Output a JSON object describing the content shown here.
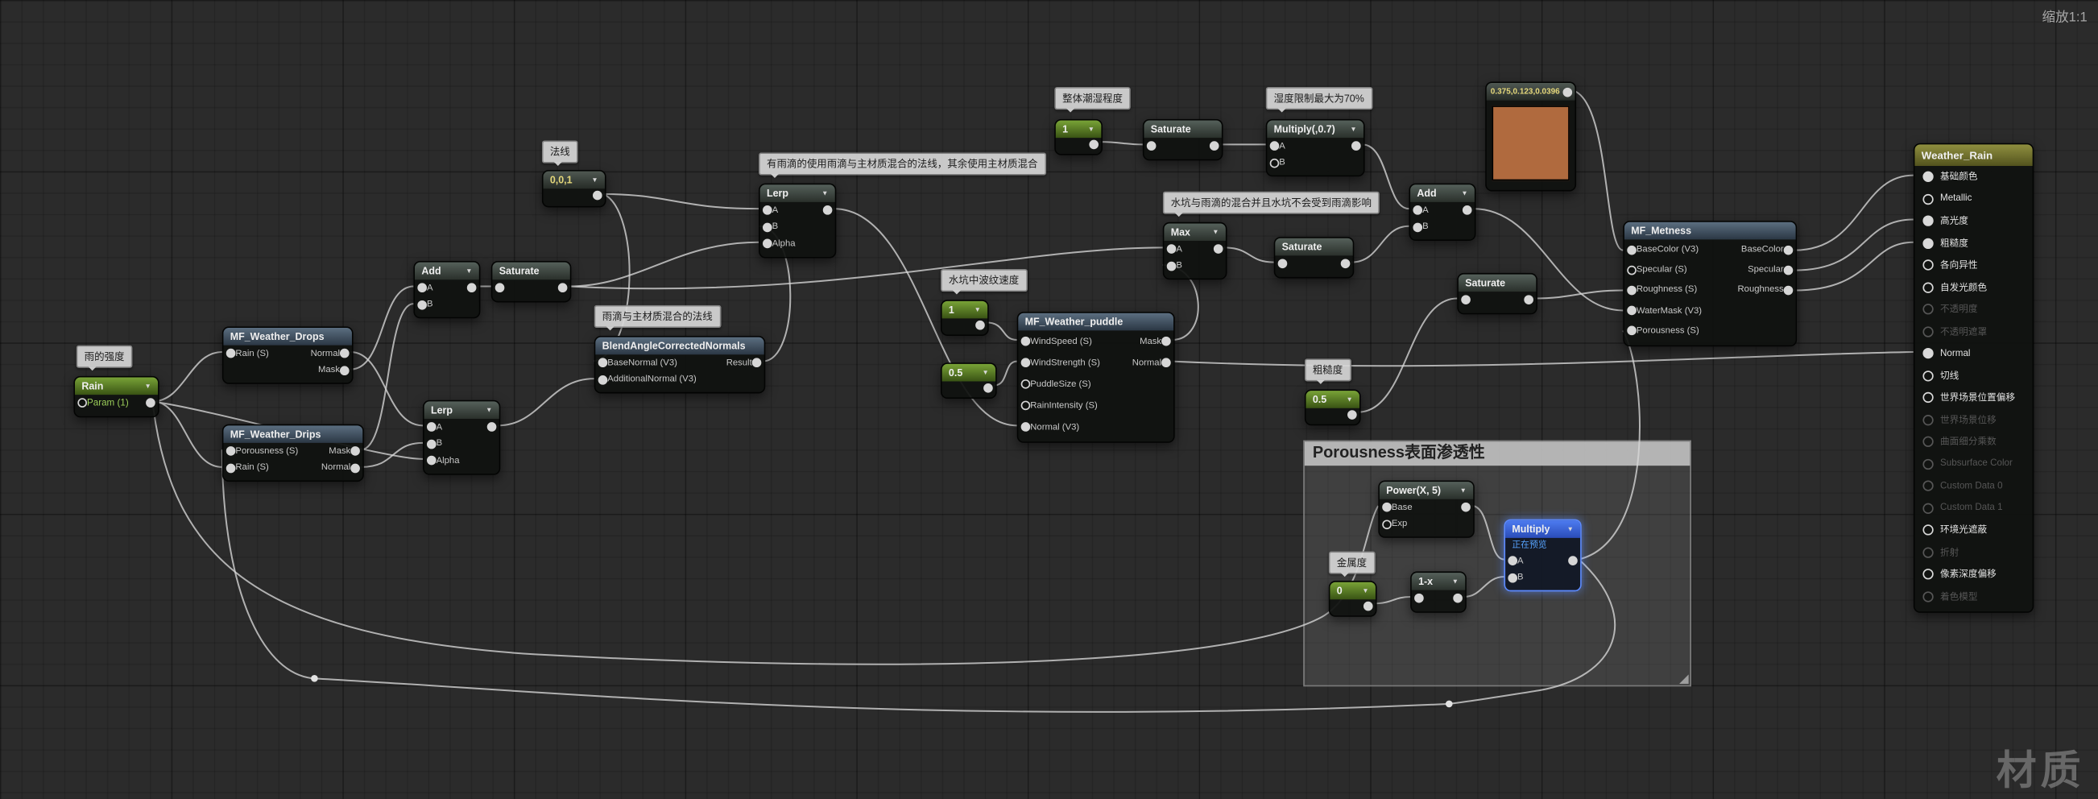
{
  "ui": {
    "zoom_label": "缩放1:1",
    "watermark": "材质"
  },
  "comment_box": {
    "title": "Porousness表面渗透性"
  },
  "comments": [
    {
      "id": "rain-strength",
      "text": "雨的强度"
    },
    {
      "id": "normal",
      "text": "法线"
    },
    {
      "id": "blend-normal",
      "text": "雨滴与主材质混合的法线"
    },
    {
      "id": "normal-choice",
      "text": "有雨滴的使用雨滴与主材质混合的法线，其余使用主材质混合"
    },
    {
      "id": "ripple-speed",
      "text": "水坑中波纹速度"
    },
    {
      "id": "overall-wetness",
      "text": "整体潮湿程度"
    },
    {
      "id": "wetness-limit",
      "text": "湿度限制最大为70%"
    },
    {
      "id": "puddle-drop-mix",
      "text": "水坑与雨滴的混合并且水坑不会受到雨滴影响"
    },
    {
      "id": "roughness",
      "text": "粗糙度"
    },
    {
      "id": "metallic",
      "text": "金属度"
    }
  ],
  "nodes": [
    {
      "id": "rain",
      "type": "param",
      "title": "Rain",
      "arrow": true,
      "rows": [
        {
          "in": "Param (1)",
          "out": "",
          "outf": true
        }
      ]
    },
    {
      "id": "drops",
      "type": "mf",
      "title": "MF_Weather_Drops",
      "rows": [
        {
          "in": "Rain (S)",
          "inf": true,
          "out": "Normal",
          "outf": true
        },
        {
          "out": "Mask",
          "outf": true
        }
      ]
    },
    {
      "id": "drips",
      "type": "mf",
      "title": "MF_Weather_Drips",
      "rows": [
        {
          "in": "Porousness (S)",
          "inf": true,
          "out": "Mask",
          "outf": true
        },
        {
          "in": "Rain (S)",
          "inf": true,
          "out": "Normal",
          "outf": true
        }
      ]
    },
    {
      "id": "add1",
      "type": "op",
      "title": "Add",
      "arrow": true,
      "rows": [
        {
          "in": "A",
          "inf": true,
          "out": "",
          "outf": true
        },
        {
          "in": "B",
          "inf": true
        }
      ]
    },
    {
      "id": "sat1",
      "type": "op",
      "title": "Saturate",
      "rows": [
        {
          "in": "",
          "inf": true,
          "out": "",
          "outf": true
        }
      ]
    },
    {
      "id": "vec001",
      "type": "const3",
      "title": "0,0,1",
      "arrow": true,
      "rows": [
        {
          "out": "",
          "outf": true
        }
      ]
    },
    {
      "id": "lerp1",
      "type": "op",
      "title": "Lerp",
      "arrow": true,
      "rows": [
        {
          "in": "A",
          "inf": true,
          "out": "",
          "outf": true
        },
        {
          "in": "B",
          "inf": true
        },
        {
          "in": "Alpha",
          "inf": true
        }
      ]
    },
    {
      "id": "blend",
      "type": "mf",
      "title": "BlendAngleCorrectedNormals",
      "rows": [
        {
          "in": "BaseNormal (V3)",
          "inf": true,
          "out": "Result",
          "outf": true
        },
        {
          "in": "AdditionalNormal (V3)",
          "inf": true
        }
      ]
    },
    {
      "id": "lerp2",
      "type": "op",
      "title": "Lerp",
      "arrow": true,
      "rows": [
        {
          "in": "A",
          "inf": true,
          "out": "",
          "outf": true
        },
        {
          "in": "B",
          "inf": true
        },
        {
          "in": "Alpha",
          "inf": true
        }
      ]
    },
    {
      "id": "one1",
      "type": "const",
      "title": "1",
      "arrow": true,
      "rows": [
        {
          "out": "",
          "outf": true
        }
      ]
    },
    {
      "id": "half1",
      "type": "const",
      "title": "0.5",
      "arrow": true,
      "rows": [
        {
          "out": "",
          "outf": true
        }
      ]
    },
    {
      "id": "puddle",
      "type": "mf",
      "title": "MF_Weather_puddle",
      "rows": [
        {
          "in": "WindSpeed (S)",
          "inf": true,
          "out": "Mask",
          "outf": true
        },
        {
          "in": "WindStrength (S)",
          "inf": true,
          "out": "Normal",
          "outf": true
        },
        {
          "in": "PuddleSize (S)"
        },
        {
          "in": "RainIntensity (S)"
        },
        {
          "in": "Normal (V3)",
          "inf": true
        }
      ]
    },
    {
      "id": "one2",
      "type": "const",
      "title": "1",
      "arrow": true,
      "rows": [
        {
          "out": "",
          "outf": true
        }
      ]
    },
    {
      "id": "sat2",
      "type": "op",
      "title": "Saturate",
      "rows": [
        {
          "in": "",
          "inf": true,
          "out": "",
          "outf": true
        }
      ]
    },
    {
      "id": "mul07",
      "type": "op",
      "title": "Multiply(,0.7)",
      "arrow": true,
      "rows": [
        {
          "in": "A",
          "inf": true,
          "out": "",
          "outf": true
        },
        {
          "in": "B"
        }
      ]
    },
    {
      "id": "max1",
      "type": "op",
      "title": "Max",
      "arrow": true,
      "rows": [
        {
          "in": "A",
          "inf": true,
          "out": "",
          "outf": true
        },
        {
          "in": "B",
          "inf": true
        }
      ]
    },
    {
      "id": "sat3",
      "type": "op",
      "title": "Saturate",
      "rows": [
        {
          "in": "",
          "inf": true,
          "out": "",
          "outf": true
        }
      ]
    },
    {
      "id": "add2",
      "type": "op",
      "title": "Add",
      "arrow": true,
      "rows": [
        {
          "in": "A",
          "inf": true,
          "out": "",
          "outf": true
        },
        {
          "in": "B",
          "inf": true
        }
      ]
    },
    {
      "id": "swatch",
      "type": "color",
      "title": "0.375,0.123,0.0396",
      "color": "#b06a3e",
      "rows": []
    },
    {
      "id": "sat4",
      "type": "op",
      "title": "Saturate",
      "rows": [
        {
          "in": "",
          "inf": true,
          "out": "",
          "outf": true
        }
      ]
    },
    {
      "id": "metness",
      "type": "mf",
      "title": "MF_Metness",
      "rows": [
        {
          "in": "BaseColor (V3)",
          "inf": true,
          "out": "BaseColor",
          "outf": true
        },
        {
          "in": "Specular (S)",
          "out": "Specular",
          "outf": true
        },
        {
          "in": "Roughness (S)",
          "inf": true,
          "out": "Roughness",
          "outf": true
        },
        {
          "in": "WaterMask (V3)",
          "inf": true
        },
        {
          "in": "Porousness (S)",
          "inf": true
        }
      ]
    },
    {
      "id": "half2",
      "type": "const",
      "title": "0.5",
      "arrow": true,
      "rows": [
        {
          "out": "",
          "outf": true
        }
      ]
    },
    {
      "id": "power",
      "type": "op",
      "title": "Power(X, 5)",
      "arrow": true,
      "rows": [
        {
          "in": "Base",
          "inf": true,
          "out": "",
          "outf": true
        },
        {
          "in": "Exp"
        }
      ]
    },
    {
      "id": "zero",
      "type": "const",
      "title": "0",
      "arrow": true,
      "rows": [
        {
          "out": "",
          "outf": true
        }
      ]
    },
    {
      "id": "oneminus",
      "type": "op",
      "title": "1-x",
      "arrow": true,
      "rows": [
        {
          "in": "",
          "inf": true,
          "out": "",
          "outf": true
        }
      ]
    },
    {
      "id": "mulsel",
      "type": "op sel",
      "title": "Multiply",
      "arrow": true,
      "subtitle": "正在预览",
      "rows": [
        {
          "in": "A",
          "inf": true,
          "out": "",
          "outf": true
        },
        {
          "in": "B",
          "inf": true
        }
      ]
    },
    {
      "id": "main",
      "type": "main",
      "title": "Weather_Rain",
      "pins": [
        {
          "label": "基础颜色",
          "on": true,
          "connected": true
        },
        {
          "label": "Metallic",
          "on": true,
          "connected": false
        },
        {
          "label": "高光度",
          "on": true,
          "connected": true
        },
        {
          "label": "粗糙度",
          "on": true,
          "connected": true
        },
        {
          "label": "各向异性",
          "on": true,
          "connected": false
        },
        {
          "label": "自发光颜色",
          "on": true,
          "connected": false
        },
        {
          "label": "不透明度",
          "on": false,
          "connected": false
        },
        {
          "label": "不透明遮罩",
          "on": false,
          "connected": false
        },
        {
          "label": "Normal",
          "on": true,
          "connected": true
        },
        {
          "label": "切线",
          "on": true,
          "connected": false
        },
        {
          "label": "世界场景位置偏移",
          "on": true,
          "connected": false
        },
        {
          "label": "世界场景位移",
          "on": false,
          "connected": false
        },
        {
          "label": "曲面细分乘数",
          "on": false,
          "connected": false
        },
        {
          "label": "Subsurface Color",
          "on": false,
          "connected": false
        },
        {
          "label": "Custom Data 0",
          "on": false,
          "connected": false
        },
        {
          "label": "Custom Data 1",
          "on": false,
          "connected": false
        },
        {
          "label": "环境光遮蔽",
          "on": true,
          "connected": false
        },
        {
          "label": "折射",
          "on": false,
          "connected": false
        },
        {
          "label": "像素深度偏移",
          "on": true,
          "connected": false
        },
        {
          "label": "着色模型",
          "on": false,
          "connected": false
        }
      ]
    }
  ]
}
